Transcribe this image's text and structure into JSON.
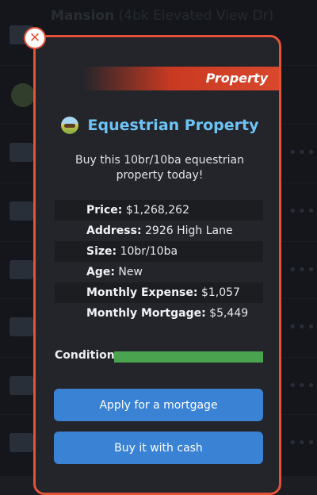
{
  "background": {
    "first_item": {
      "title_bold": "Mansion",
      "title_rest": "(4bk Elevated View Dr)"
    },
    "rows": 9,
    "more_icon": "ellipsis"
  },
  "modal": {
    "ribbon_label": "Property",
    "close_icon": "close-x",
    "title": "Equestrian Property",
    "title_icon": "field-icon",
    "description": "Buy this 10br/10ba equestrian property today!",
    "details": [
      {
        "label": "Price:",
        "value": "$1,268,262"
      },
      {
        "label": "Address:",
        "value": "2926 High Lane"
      },
      {
        "label": "Size:",
        "value": "10br/10ba"
      },
      {
        "label": "Age:",
        "value": "New"
      },
      {
        "label": "Monthly Expense:",
        "value": "$1,057"
      },
      {
        "label": "Monthly Mortgage:",
        "value": "$5,449"
      }
    ],
    "condition": {
      "label": "Condition",
      "level": 1.0
    },
    "buttons": {
      "mortgage": "Apply for a mortgage",
      "cash": "Buy it with cash"
    }
  },
  "colors": {
    "accent": "#e2533a",
    "title": "#6ec3f5",
    "button": "#3a82d4",
    "condition": "#4aa34e"
  }
}
